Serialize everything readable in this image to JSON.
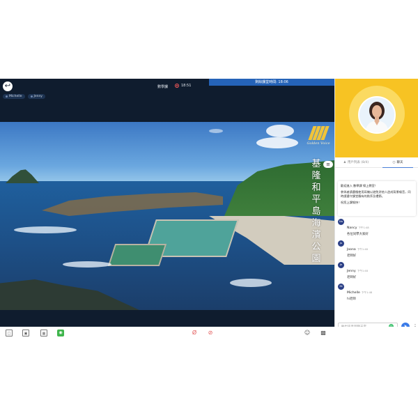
{
  "header": {
    "room_title": "數學課",
    "elapsed": "18:51",
    "remaining_label": "剩餘課堂時間: 18:06"
  },
  "participants": [
    "Michelle",
    "Jenny"
  ],
  "video": {
    "logo_text": "Golden Voice",
    "caption": "基隆和平島海濱公園"
  },
  "panel": {
    "tabs": [
      {
        "label": "用戶列表 (8/4)"
      },
      {
        "label": "聊天"
      }
    ],
    "welcome_lines": [
      "歡迎進入 數學課 線上教室！",
      "參與者請遵循使用耳機以避免對他人造成背景噪音，同時請遵守課堂應有的秩序及禮節。",
      "祝您上課愉快！"
    ],
    "messages": [
      {
        "initials": "Na",
        "name": "Nancy",
        "time": "下午1:48",
        "text": "各位同學大家好"
      },
      {
        "initials": "Jo",
        "name": "Joona",
        "time": "下午1:48",
        "text": "老師好"
      },
      {
        "initials": "Je",
        "name": "Jenny",
        "time": "下午1:48",
        "text": "老師好"
      },
      {
        "initials": "Mi",
        "name": "Michelle",
        "time": "下午1:48",
        "text": "hi老師"
      }
    ],
    "input_placeholder": "輸出訊息到聊天室"
  },
  "icons": {
    "back": "back-icon",
    "record": "record-icon",
    "send": "send-icon",
    "more": "more-icon"
  },
  "colors": {
    "stage_bg": "#0f1c2e",
    "accent_blue": "#2563b8",
    "teacher_bg": "#f7c323",
    "send_blue": "#3a7be8"
  }
}
